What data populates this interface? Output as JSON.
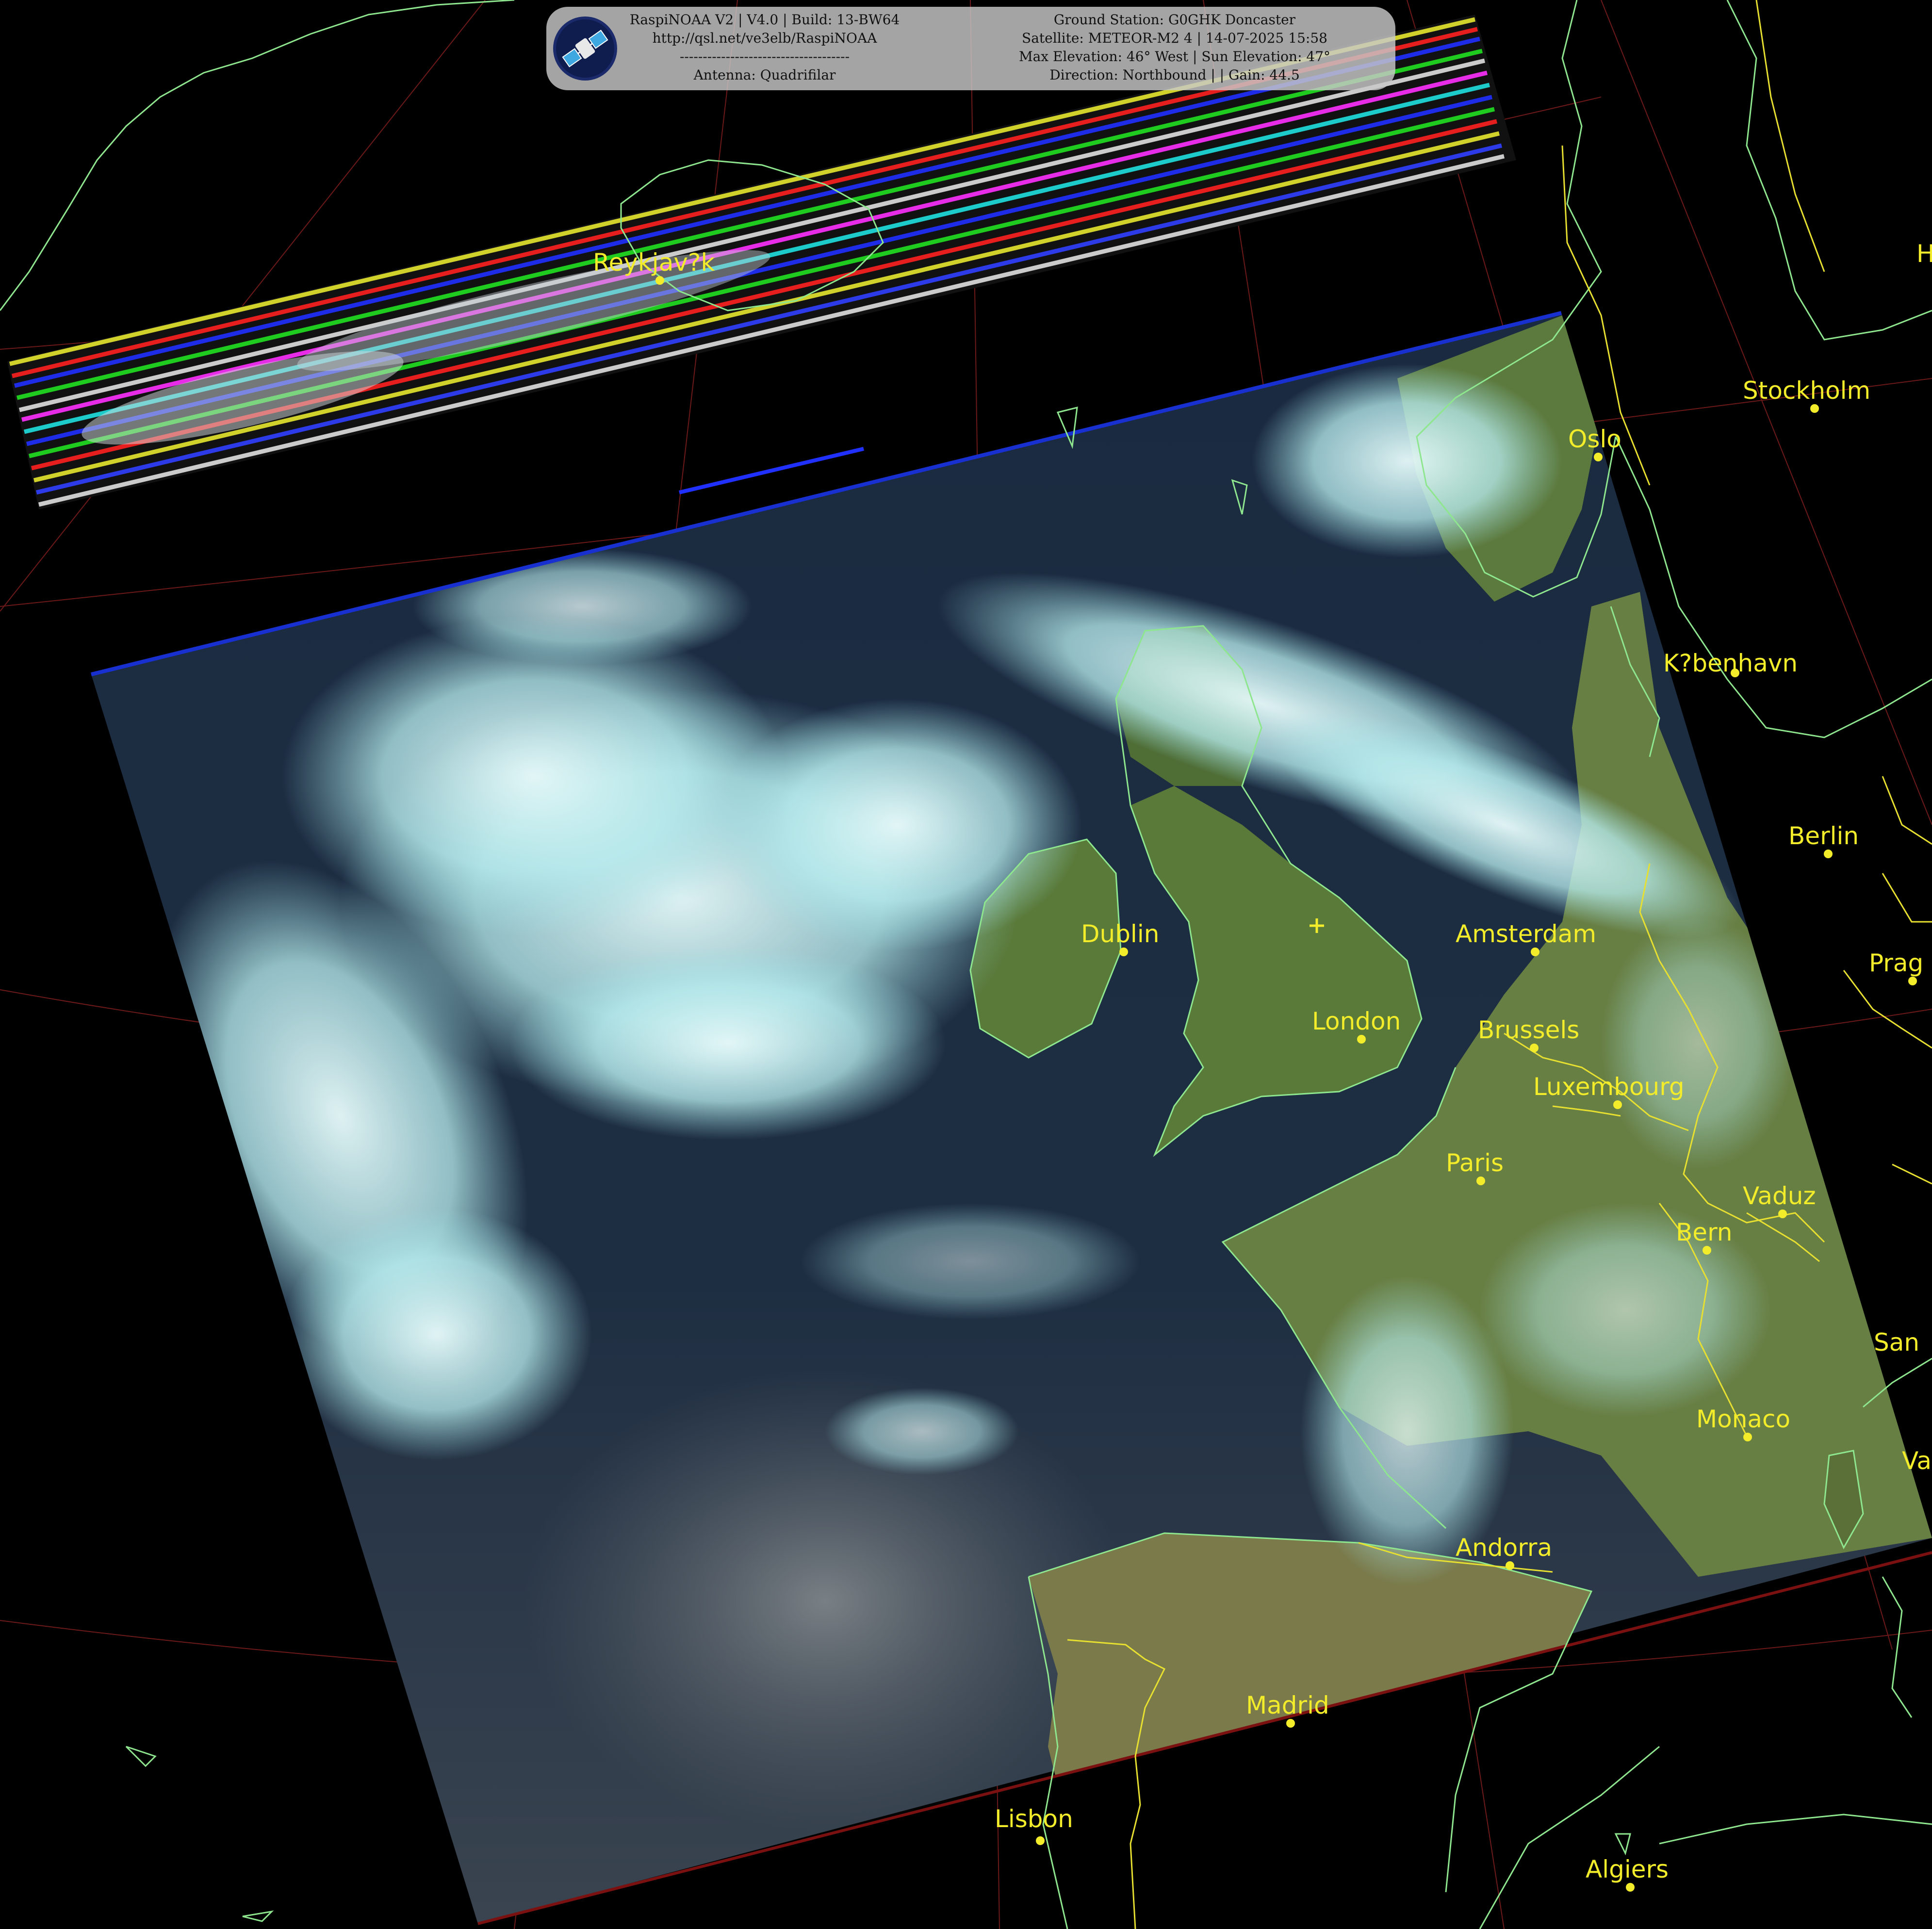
{
  "header": {
    "left_lines": [
      "RaspiNOAA V2 | V4.0 | Build: 13-BW64",
      "http://qsl.net/ve3elb/RaspiNOAA",
      "-------------------------------------",
      "Antenna: Quadrifilar"
    ],
    "right_lines": [
      "Ground Station: G0GHK Doncaster",
      "Satellite: METEOR-M2 4 | 14-07-2025 15:58",
      "Max Elevation: 46° West | Sun Elevation: 47°",
      "Direction: Northbound | | Gain: 44.5"
    ]
  },
  "logo_icon": "satellite-icon",
  "colors": {
    "label": "#f2ec2a",
    "coastline": "#8ee68e",
    "border": "#e8e030",
    "graticule": "#8a2020"
  },
  "cities": [
    {
      "name": "Reykjav?k"
    },
    {
      "name": "Stockholm"
    },
    {
      "name": "Oslo"
    },
    {
      "name": "K?benhavn"
    },
    {
      "name": "Berlin"
    },
    {
      "name": "Prag"
    },
    {
      "name": "Amsterdam"
    },
    {
      "name": "Dublin"
    },
    {
      "name": "London"
    },
    {
      "name": "Brussels"
    },
    {
      "name": "Luxembourg"
    },
    {
      "name": "Paris"
    },
    {
      "name": "Vaduz"
    },
    {
      "name": "Bern"
    },
    {
      "name": "San"
    },
    {
      "name": "Monaco"
    },
    {
      "name": "Va"
    },
    {
      "name": "Andorra"
    },
    {
      "name": "Madrid"
    },
    {
      "name": "Lisbon"
    },
    {
      "name": "Algiers"
    },
    {
      "name": "H"
    }
  ]
}
